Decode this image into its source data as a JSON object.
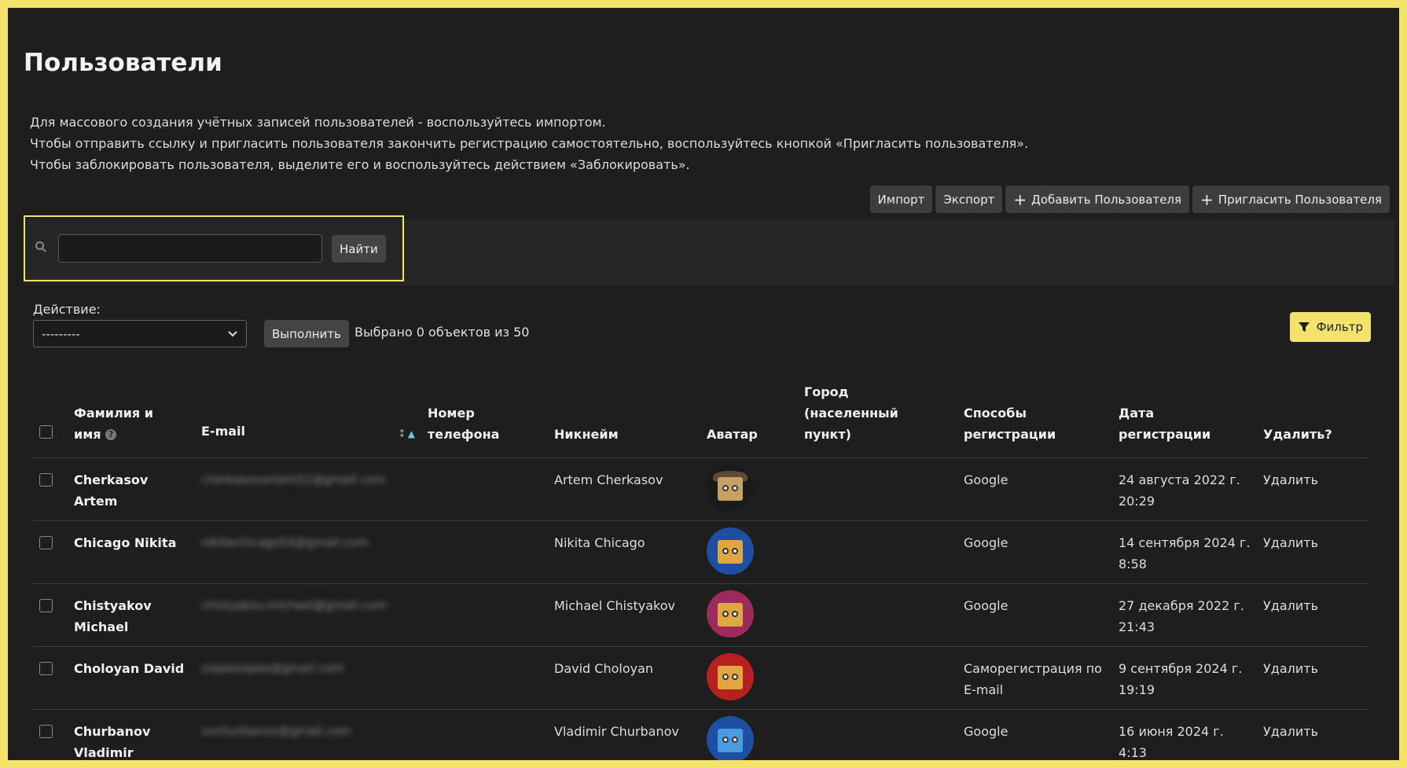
{
  "page": {
    "title": "Пользователи"
  },
  "help_lines": [
    "Для массового создания учётных записей пользователей - воспользуйтесь импортом.",
    "Чтобы отправить ссылку и пригласить пользователя закончить регистрацию самостоятельно, воспользуйтесь кнопкой «Пригласить пользователя».",
    "Чтобы заблокировать пользователя, выделите его и воспользуйтесь действием «Заблокировать»."
  ],
  "toolbar": {
    "import_label": "Импорт",
    "export_label": "Экспорт",
    "add_label": "Добавить Пользователя",
    "invite_label": "Пригласить Пользователя"
  },
  "search": {
    "value": "",
    "placeholder": "",
    "button_label": "Найти"
  },
  "actions": {
    "label": "Действие:",
    "selected_option": "---------",
    "run_label": "Выполнить",
    "selected_count": "Выбрано 0 объектов из 50"
  },
  "filter": {
    "label": "Фильтр"
  },
  "table": {
    "headers": {
      "name": [
        "Фамилия и",
        "имя"
      ],
      "email": "E-mail",
      "phone": [
        "Номер",
        "телефона"
      ],
      "nickname": "Никнейм",
      "avatar": "Аватар",
      "city": [
        "Город",
        "(населенный",
        "пункт)"
      ],
      "reg_methods": [
        "Способы",
        "регистрации"
      ],
      "reg_date": [
        "Дата",
        "регистрации"
      ],
      "delete": "Удалить?"
    },
    "rows": [
      {
        "name": "Cherkasov Artem",
        "email": "cherkasovartem51@gmail.com",
        "phone": "",
        "nickname": "Artem Cherkasov",
        "city": "",
        "reg_method": "Google",
        "reg_date": "24 августа 2022 г. 20:29",
        "delete": "Удалить",
        "avatar_bg": "#1a1a1a",
        "avatar_box": "#c9a063",
        "hat": true
      },
      {
        "name": "Chicago Nikita",
        "email": "nikitachicago54@gmail.com",
        "phone": "",
        "nickname": "Nikita Chicago",
        "city": "",
        "reg_method": "Google",
        "reg_date": "14 сентября 2024 г. 8:58",
        "delete": "Удалить",
        "avatar_bg": "#1f4fa3",
        "avatar_box": "#e0a640",
        "hat": false
      },
      {
        "name": "Chistyakov Michael",
        "email": "chistyakov.michael@gmail.com",
        "phone": "",
        "nickname": "Michael Chistyakov",
        "city": "",
        "reg_method": "Google",
        "reg_date": "27 декабря 2022 г. 21:43",
        "delete": "Удалить",
        "avatar_bg": "#9c2a5a",
        "avatar_box": "#e0a640",
        "hat": false
      },
      {
        "name": "Choloyan David",
        "email": "siapesiapes@gmail.com",
        "phone": "",
        "nickname": "David Choloyan",
        "city": "",
        "reg_method": "Саморегистрация по E-mail",
        "reg_date": "9 сентября 2024 г. 19:19",
        "delete": "Удалить",
        "avatar_bg": "#b8201f",
        "avatar_box": "#e0a640",
        "hat": false
      },
      {
        "name": "Churbanov Vladimir",
        "email": "vvchurbanov@gmail.com",
        "phone": "",
        "nickname": "Vladimir Churbanov",
        "city": "",
        "reg_method": "Google",
        "reg_date": "16 июня 2024 г. 4:13",
        "delete": "Удалить",
        "avatar_bg": "#1f4fa3",
        "avatar_box": "#4a9be0",
        "hat": false
      }
    ]
  }
}
